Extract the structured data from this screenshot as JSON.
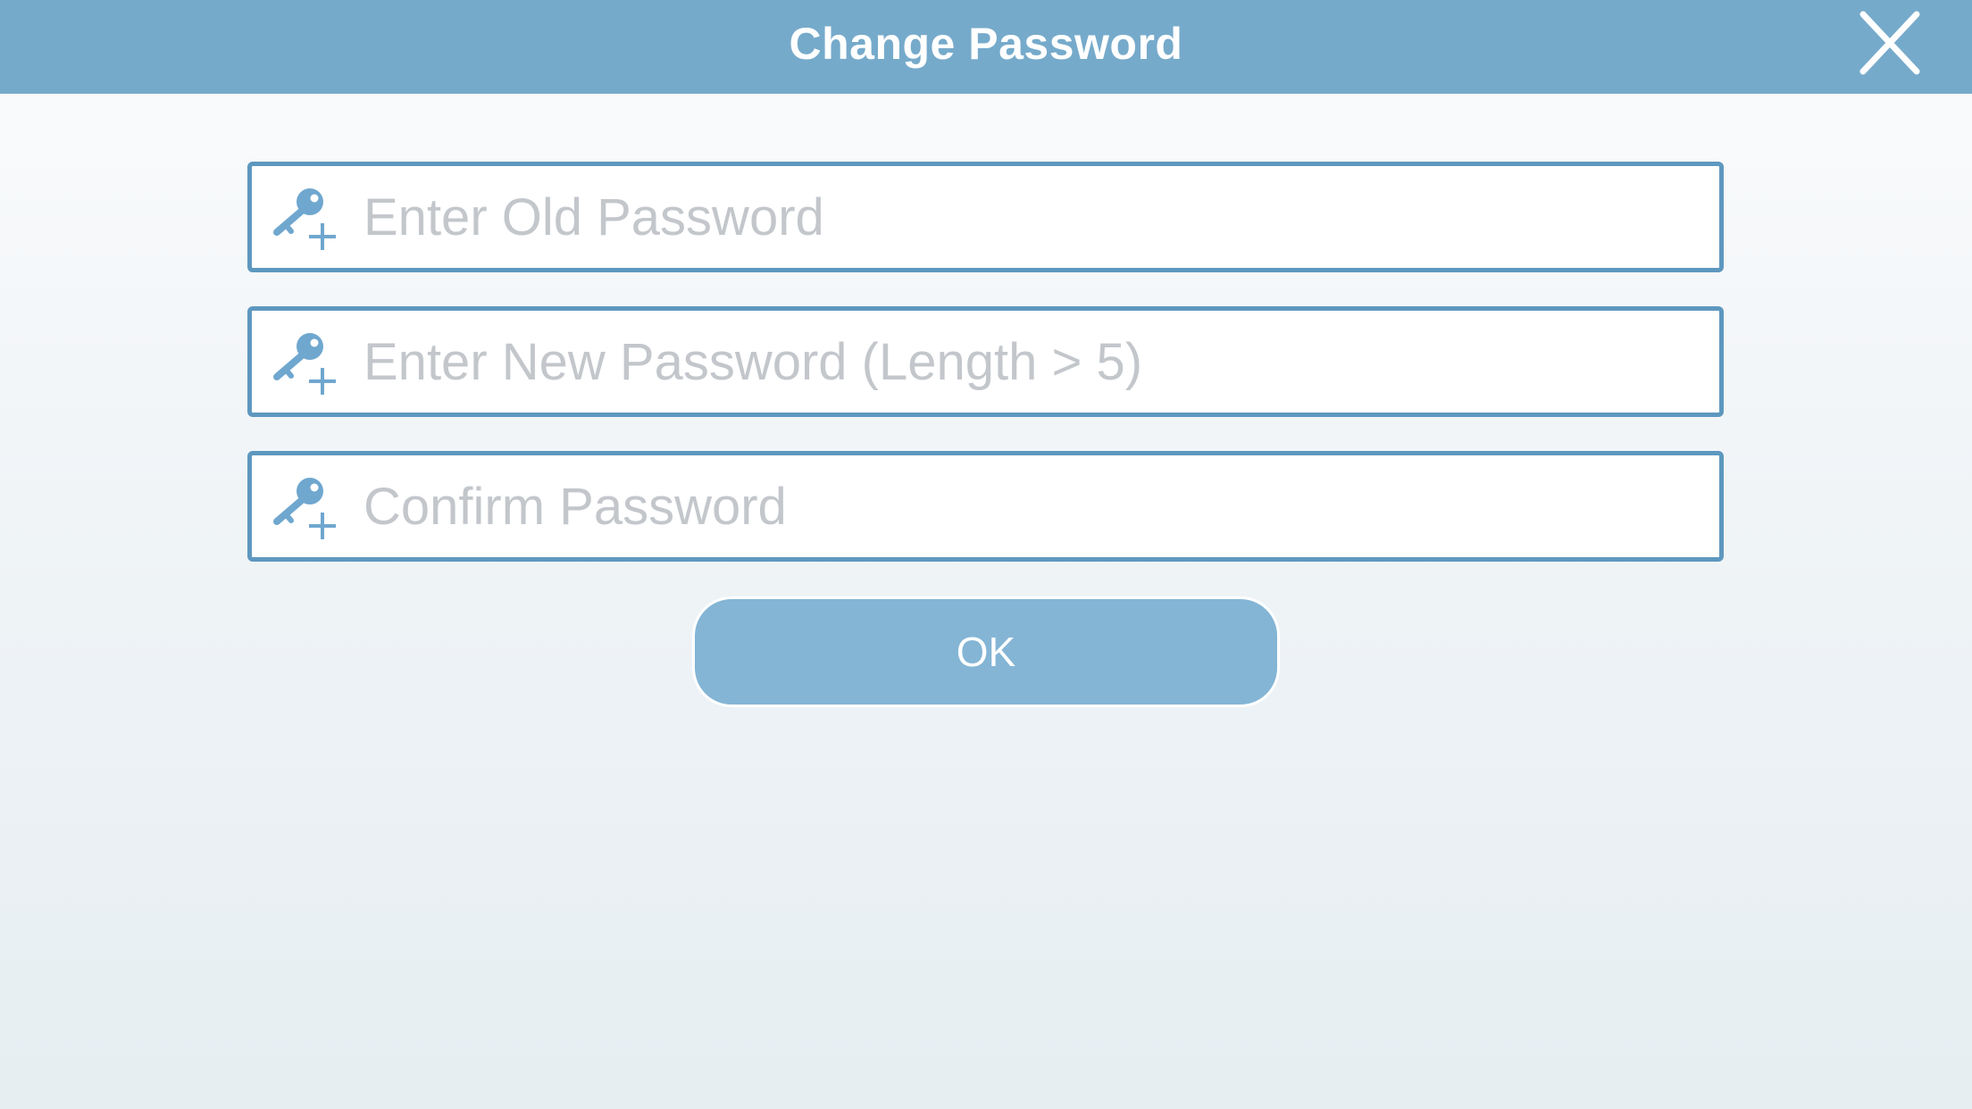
{
  "header": {
    "title": "Change Password"
  },
  "form": {
    "old_password": {
      "placeholder": "Enter Old Password",
      "value": ""
    },
    "new_password": {
      "placeholder": "Enter New Password (Length > 5)",
      "value": ""
    },
    "confirm_password": {
      "placeholder": "Confirm Password",
      "value": ""
    }
  },
  "ok_button": {
    "label": "OK"
  },
  "icons": {
    "close": "close-icon",
    "field": "key-plus-icon"
  },
  "colors": {
    "header_bg": "#76aacb",
    "field_border": "#5e98bf",
    "icon": "#6fa7cf",
    "button_bg": "#84b5d5",
    "placeholder": "#c3c7cc"
  }
}
